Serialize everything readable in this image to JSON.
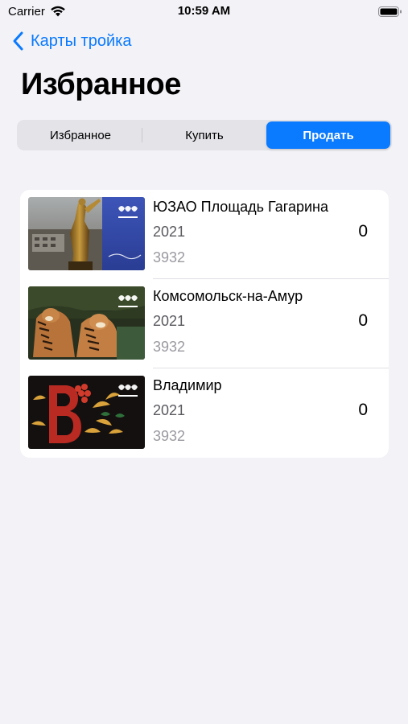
{
  "status_bar": {
    "carrier": "Carrier",
    "time": "10:59 AM"
  },
  "nav": {
    "back_label": "Карты тройка",
    "title": "Избранное"
  },
  "segments": [
    {
      "label": "Избранное",
      "active": false
    },
    {
      "label": "Купить",
      "active": false
    },
    {
      "label": "Продать",
      "active": true
    }
  ],
  "cards": [
    {
      "name": "ЮЗАО Площадь Гагарина",
      "year": "2021",
      "code": "3932",
      "count": "0",
      "image": "gagarin-monument-card"
    },
    {
      "name": "Комсомольск-на-Амур",
      "year": "2021",
      "code": "3932",
      "count": "0",
      "image": "tigers-card"
    },
    {
      "name": "Владимир",
      "year": "2021",
      "code": "3932",
      "count": "0",
      "image": "khokhloma-letter-card"
    }
  ],
  "colors": {
    "accent": "#0a7aff",
    "background": "#f2f2f7"
  }
}
